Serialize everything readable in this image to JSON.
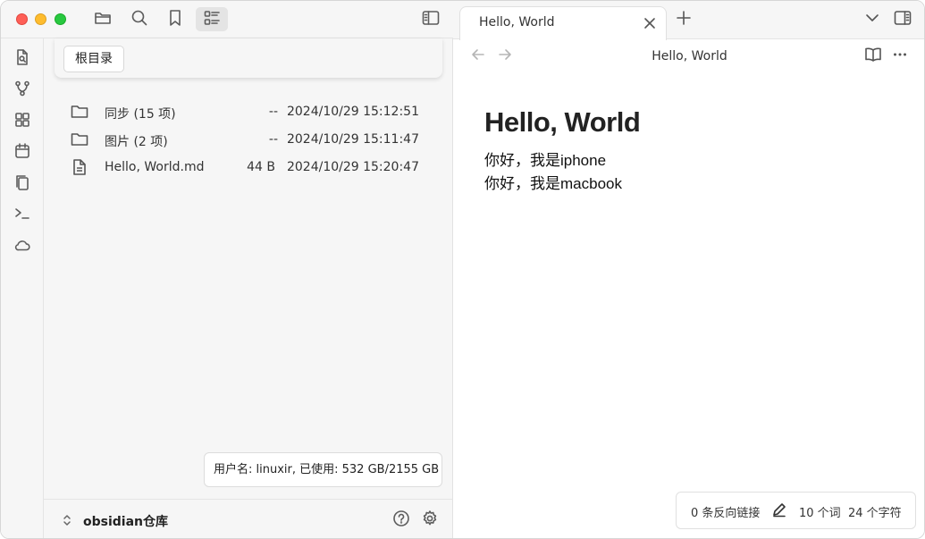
{
  "toolbar": {
    "buttons": [
      {
        "icon": "folder-icon",
        "active": false
      },
      {
        "icon": "search-icon",
        "active": false
      },
      {
        "icon": "bookmark-icon",
        "active": false
      },
      {
        "icon": "list-view-icon",
        "active": true
      }
    ],
    "sidebar_toggle_icon": "sidebar-left-icon"
  },
  "ribbon": {
    "items": [
      "file-search-icon",
      "graph-icon",
      "grid-icon",
      "calendar-icon",
      "copy-icon",
      "terminal-icon",
      "cloud-icon"
    ]
  },
  "explorer": {
    "root_label": "根目录",
    "files": [
      {
        "name": "同步 (15 项)",
        "size": "--",
        "date": "2024/10/29 15:12:51",
        "type": "folder"
      },
      {
        "name": "图片 (2 项)",
        "size": "--",
        "date": "2024/10/29 15:11:47",
        "type": "folder"
      },
      {
        "name": "Hello, World.md",
        "size": "44 B",
        "date": "2024/10/29 15:20:47",
        "type": "file"
      }
    ],
    "usage": "用户名: linuxir, 已使用: 532 GB/2155 GB"
  },
  "vault": {
    "name": "obsidian仓库",
    "help_icon": "help-icon",
    "settings_icon": "gear-icon"
  },
  "editor": {
    "tab_title": "Hello, World",
    "view_title": "Hello, World",
    "heading": "Hello, World",
    "lines": [
      "你好，我是iphone",
      "你好，我是macbook"
    ]
  },
  "status": {
    "backlinks": "0 条反向链接",
    "words": "10 个词",
    "chars": "24 个字符"
  },
  "colors": {
    "traffic_red": "#fe5f57",
    "traffic_yellow": "#febc2e",
    "traffic_green": "#28c840",
    "sidebar_bg": "#f6f6f6"
  }
}
